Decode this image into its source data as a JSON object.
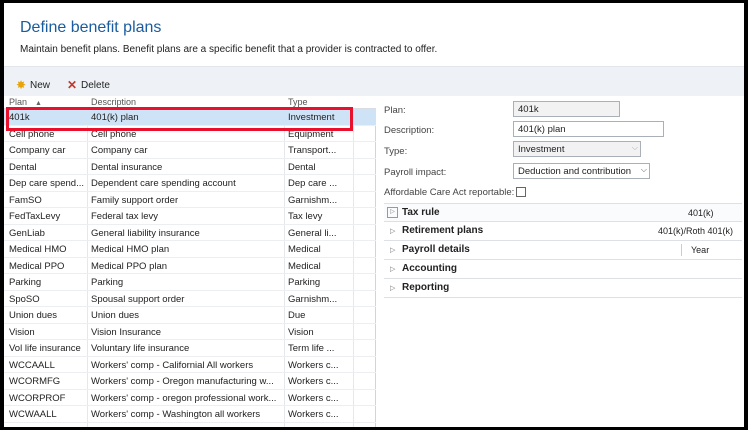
{
  "header": {
    "title": "Define benefit plans",
    "subtitle": "Maintain benefit plans. Benefit plans are a specific benefit that a provider is contracted to offer."
  },
  "toolbar": {
    "new_label": "New",
    "delete_label": "Delete",
    "new_icon": "sparkle-new-icon",
    "delete_icon": "x-delete-icon"
  },
  "grid": {
    "columns": [
      "Plan",
      "Description",
      "Type"
    ],
    "selected_index": 0,
    "rows": [
      {
        "plan": "401k",
        "description": "401(k) plan",
        "type": "Investment"
      },
      {
        "plan": "Cell phone",
        "description": "Cell phone",
        "type": "Equipment"
      },
      {
        "plan": "Company car",
        "description": "Company car",
        "type": "Transport..."
      },
      {
        "plan": "Dental",
        "description": "Dental insurance",
        "type": "Dental"
      },
      {
        "plan": "Dep care spend...",
        "description": "Dependent care spending account",
        "type": "Dep care ..."
      },
      {
        "plan": "FamSO",
        "description": "Family support order",
        "type": "Garnishm..."
      },
      {
        "plan": "FedTaxLevy",
        "description": "Federal tax levy",
        "type": "Tax levy"
      },
      {
        "plan": "GenLiab",
        "description": "General liability insurance",
        "type": "General li..."
      },
      {
        "plan": "Medical HMO",
        "description": "Medical HMO plan",
        "type": "Medical"
      },
      {
        "plan": "Medical PPO",
        "description": "Medical PPO plan",
        "type": "Medical"
      },
      {
        "plan": "Parking",
        "description": "Parking",
        "type": "Parking"
      },
      {
        "plan": "SpoSO",
        "description": "Spousal support order",
        "type": "Garnishm..."
      },
      {
        "plan": "Union dues",
        "description": "Union dues",
        "type": "Due"
      },
      {
        "plan": "Vision",
        "description": "Vision Insurance",
        "type": "Vision"
      },
      {
        "plan": "Vol life insurance",
        "description": "Voluntary life insurance",
        "type": "Term life ..."
      },
      {
        "plan": "WCCAALL",
        "description": "Workers' comp - Californial All workers",
        "type": "Workers c..."
      },
      {
        "plan": "WCORMFG",
        "description": "Workers' comp - Oregon manufacturing w...",
        "type": "Workers c..."
      },
      {
        "plan": "WCORPROF",
        "description": "Workers' comp - oregon professional work...",
        "type": "Workers c..."
      },
      {
        "plan": "WCWAALL",
        "description": "Workers' comp - Washington all workers",
        "type": "Workers c..."
      }
    ]
  },
  "details": {
    "plan_label": "Plan:",
    "plan_value": "401k",
    "description_label": "Description:",
    "description_value": "401(k) plan",
    "type_label": "Type:",
    "type_value": "Investment",
    "payroll_label": "Payroll impact:",
    "payroll_value": "Deduction and contribution",
    "aca_label": "Affordable Care Act reportable:",
    "aca_checked": false,
    "fasttabs": [
      {
        "title": "Tax rule",
        "summary": "401(k)"
      },
      {
        "title": "Retirement plans",
        "summary": "401(k)/Roth 401(k)"
      },
      {
        "title": "Payroll details",
        "summary": "Year"
      },
      {
        "title": "Accounting",
        "summary": ""
      },
      {
        "title": "Reporting",
        "summary": ""
      }
    ]
  },
  "colors": {
    "title_blue": "#1a5c9e",
    "selected_row": "#cfe3f7",
    "highlight_red": "#e8102c",
    "toolbar_bg": "#eef2f7"
  }
}
